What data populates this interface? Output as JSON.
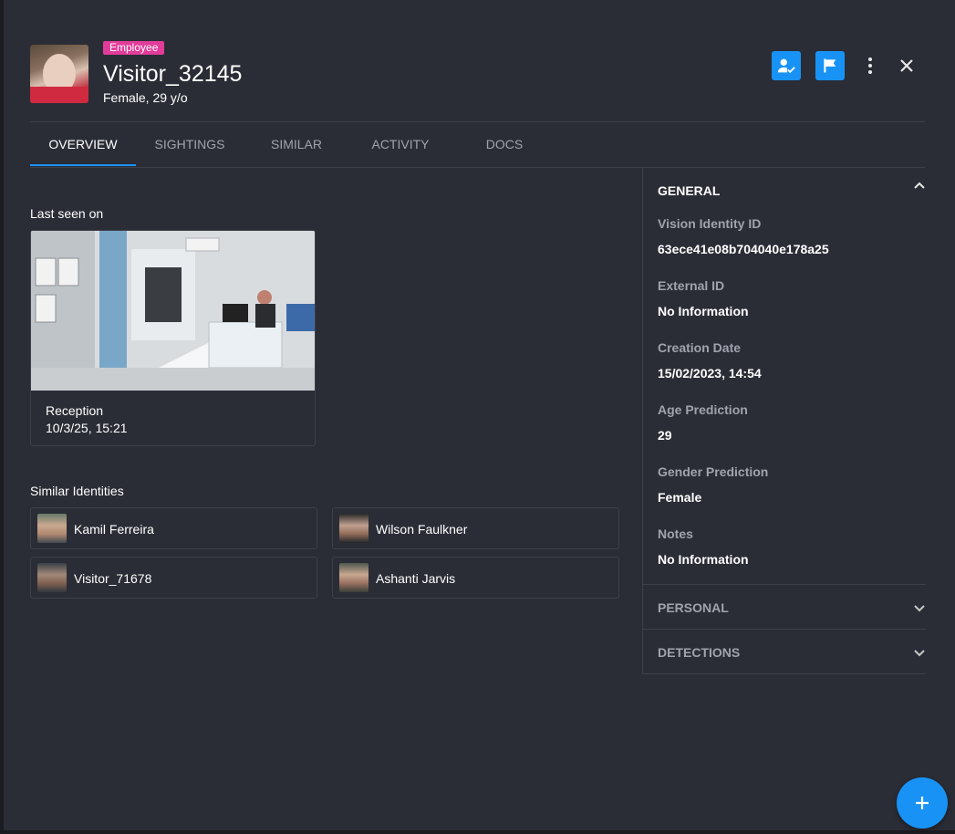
{
  "profile": {
    "badge": "Employee",
    "name": "Visitor_32145",
    "subtitle": "Female, 29 y/o"
  },
  "header_actions": {
    "verify_icon": "person-check-icon",
    "flag_icon": "flag-icon",
    "more_icon": "more-vertical-icon",
    "close_icon": "close-icon"
  },
  "tabs": [
    {
      "label": "OVERVIEW",
      "active": true
    },
    {
      "label": "SIGHTINGS",
      "active": false
    },
    {
      "label": "SIMILAR",
      "active": false
    },
    {
      "label": "ACTIVITY",
      "active": false
    },
    {
      "label": "DOCS",
      "active": false
    }
  ],
  "last_seen": {
    "label": "Last seen on",
    "camera": "Reception",
    "datetime": "10/3/25, 15:21"
  },
  "similar": {
    "label": "Similar Identities",
    "items": [
      {
        "name": "Kamil Ferreira"
      },
      {
        "name": "Wilson Faulkner"
      },
      {
        "name": "Visitor_71678"
      },
      {
        "name": "Ashanti Jarvis"
      }
    ]
  },
  "general": {
    "title": "GENERAL",
    "fields": [
      {
        "label": "Vision Identity ID",
        "value": "63ece41e08b704040e178a25"
      },
      {
        "label": "External ID",
        "value": "No Information"
      },
      {
        "label": "Creation Date",
        "value": "15/02/2023, 14:54"
      },
      {
        "label": "Age Prediction",
        "value": "29"
      },
      {
        "label": "Gender Prediction",
        "value": "Female"
      },
      {
        "label": "Notes",
        "value": "No Information"
      }
    ]
  },
  "personal": {
    "title": "PERSONAL"
  },
  "detections": {
    "title": "DETECTIONS"
  },
  "colors": {
    "accent": "#1893f5",
    "badge": "#e23c9a",
    "background": "#2b2d36"
  }
}
